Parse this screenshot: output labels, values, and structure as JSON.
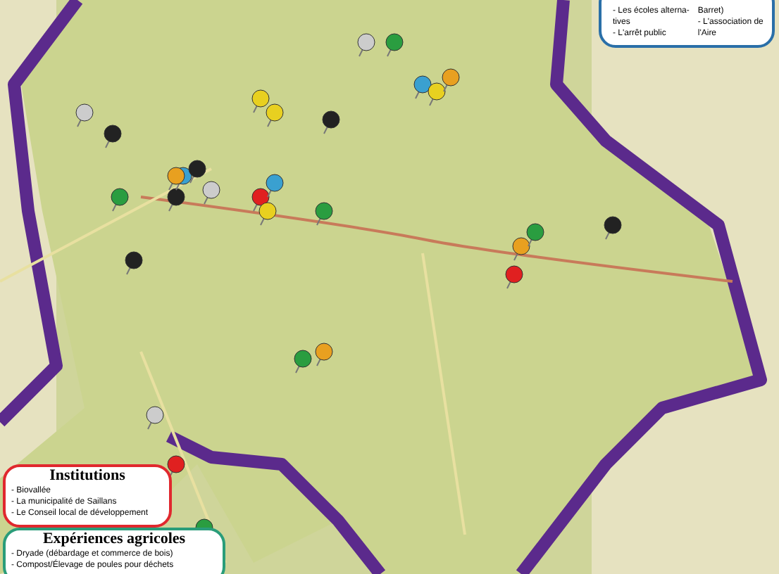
{
  "top_legend": {
    "column_1": [
      "- Les écoles alterna-",
      "tives",
      "- L'arrêt public"
    ],
    "column_2": [
      "Barret)",
      "- L'association de",
      "l'Aire"
    ]
  },
  "institutions": {
    "title": "Institutions",
    "color": "#e0282e",
    "items": [
      "- Biovallée",
      "- La municipalité de Saillans",
      "- Le Conseil local de développement"
    ]
  },
  "agricultural": {
    "title": "Expériences agricoles",
    "color": "#2a9d7a",
    "items": [
      "- Dryade (débardage et commerce de bois)",
      "- Compost/Élevage de poules pour déchets"
    ]
  }
}
